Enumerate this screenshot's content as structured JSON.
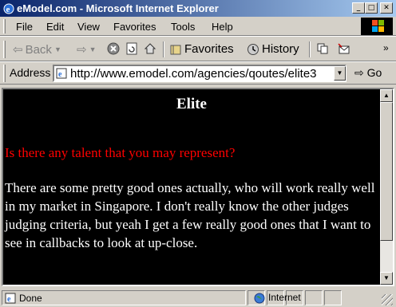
{
  "window": {
    "title": "eModel.com - Microsoft Internet Explorer"
  },
  "menu": {
    "items": [
      "File",
      "Edit",
      "View",
      "Favorites",
      "Tools",
      "Help"
    ]
  },
  "toolbar": {
    "back_label": "Back",
    "favorites_label": "Favorites",
    "history_label": "History"
  },
  "address": {
    "label": "Address",
    "url": "http://www.emodel.com/agencies/qoutes/elite3",
    "go_label": "Go"
  },
  "page": {
    "heading": "Elite",
    "question": "Is there any talent that you may represent?",
    "answer": "There are some pretty good ones actually, who will work really well in my market in Singapore. I don't really know the other judges judging criteria, but yeah I get a few really good ones that I want to see in callbacks to look at up-close."
  },
  "status": {
    "text": "Done",
    "zone": "Internet"
  },
  "colors": {
    "titlebar": "#0a246a",
    "question": "#ff0000",
    "page_bg": "#000000",
    "page_text": "#ffffff"
  },
  "icons": [
    "ie-icon",
    "minimize-icon",
    "maximize-icon",
    "close-icon",
    "windows-logo-icon",
    "back-arrow-icon",
    "forward-arrow-icon",
    "stop-icon",
    "refresh-icon",
    "home-icon",
    "favorites-icon",
    "history-icon",
    "copy-icon",
    "mail-icon",
    "page-icon",
    "go-arrow-icon",
    "globe-icon"
  ]
}
